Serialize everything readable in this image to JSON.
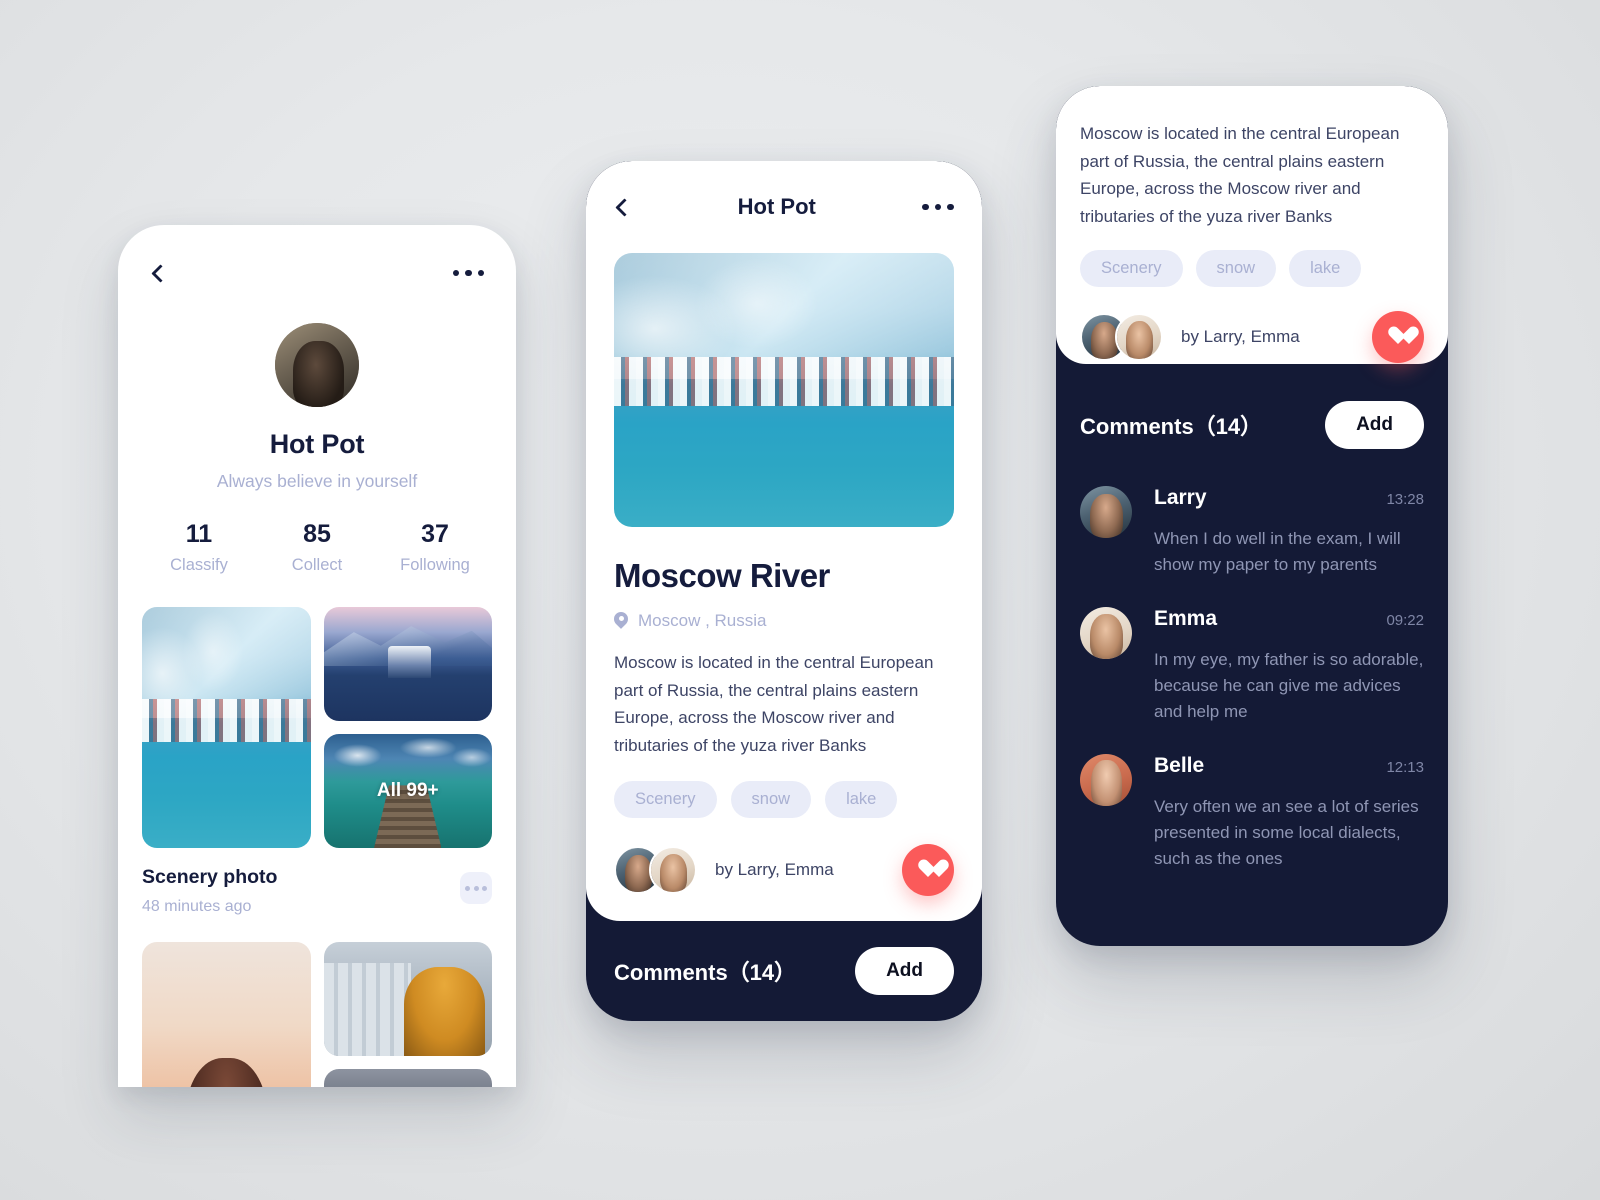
{
  "colors": {
    "accent_heart": "#fb5a5a",
    "dark_panel": "#141a36",
    "ink": "#151c3d",
    "muted": "#a9b0d2",
    "tag_bg": "#e9ecf8"
  },
  "profile_screen": {
    "back_icon": "chevron-left-icon",
    "more_icon": "ellipsis-icon",
    "avatar": "user-avatar",
    "name": "Hot Pot",
    "tagline": "Always believe in yourself",
    "stats": [
      {
        "value": "11",
        "label": "Classify"
      },
      {
        "value": "85",
        "label": "Collect"
      },
      {
        "value": "37",
        "label": "Following"
      }
    ],
    "groups": [
      {
        "title": "Scenery photo",
        "time": "48 minutes ago",
        "overlay_label": "All 99+",
        "more_icon": "ellipsis-icon"
      },
      {
        "title": "",
        "time": "",
        "overlay_label": "",
        "more_icon": "ellipsis-icon"
      }
    ]
  },
  "detail_screen": {
    "back_icon": "chevron-left-icon",
    "title": "Hot Pot",
    "more_icon": "ellipsis-icon",
    "hero_image": "moscow-river-winter-photo",
    "place_title": "Moscow River",
    "location_icon": "location-pin-icon",
    "location": "Moscow , Russia",
    "description": "Moscow is located in the central European part of Russia, the central plains eastern Europe, across the Moscow river and tributaries of the yuza river Banks",
    "tags": [
      "Scenery",
      "snow",
      "lake"
    ],
    "byline": "by Larry, Emma",
    "like_icon": "heart-icon",
    "comments_title": "Comments（14）",
    "add_label": "Add"
  },
  "comments_screen": {
    "description": "Moscow is located in the central European part of Russia, the central plains eastern Europe, across the Moscow river and tributaries of the yuza river Banks",
    "tags": [
      "Scenery",
      "snow",
      "lake"
    ],
    "byline": "by Larry, Emma",
    "like_icon": "heart-icon",
    "comments_title": "Comments（14）",
    "add_label": "Add",
    "comments": [
      {
        "name": "Larry",
        "time": "13:28",
        "text": "When I do well in the exam, I will show my paper to my parents"
      },
      {
        "name": "Emma",
        "time": "09:22",
        "text": "In my eye, my father is so adorable, because he can give me advices and help me"
      },
      {
        "name": "Belle",
        "time": "12:13",
        "text": "Very often we an see a lot of  series presented in some local dialects, such as the ones"
      }
    ]
  }
}
